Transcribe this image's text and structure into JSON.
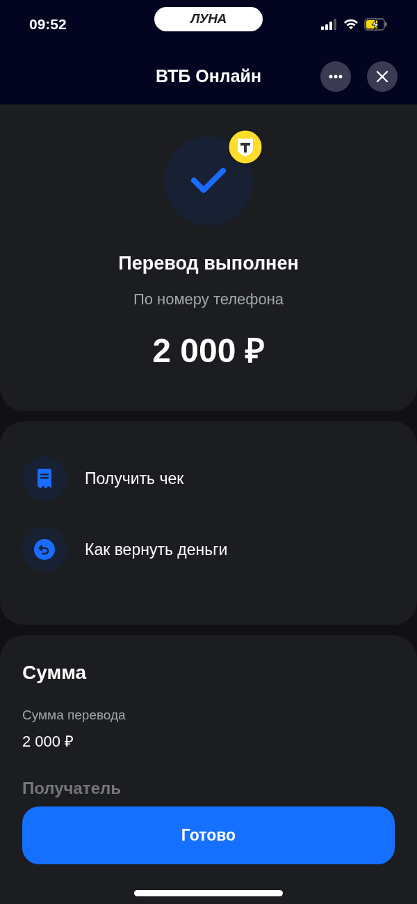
{
  "status_bar": {
    "time": "09:52",
    "carrier_logo": "ЛУНА"
  },
  "header": {
    "title": "ВТБ Онлайн"
  },
  "result": {
    "title": "Перевод выполнен",
    "subtitle": "По номеру телефона",
    "amount": "2 000 ₽"
  },
  "actions": [
    {
      "kind": "receipt",
      "label": "Получить чек"
    },
    {
      "kind": "refund",
      "label": "Как вернуть деньги"
    }
  ],
  "details": {
    "title": "Сумма",
    "fields": [
      {
        "label": "Сумма перевода",
        "value": "2 000 ₽"
      }
    ],
    "next_section": "Получатель"
  },
  "primary_button": "Готово"
}
